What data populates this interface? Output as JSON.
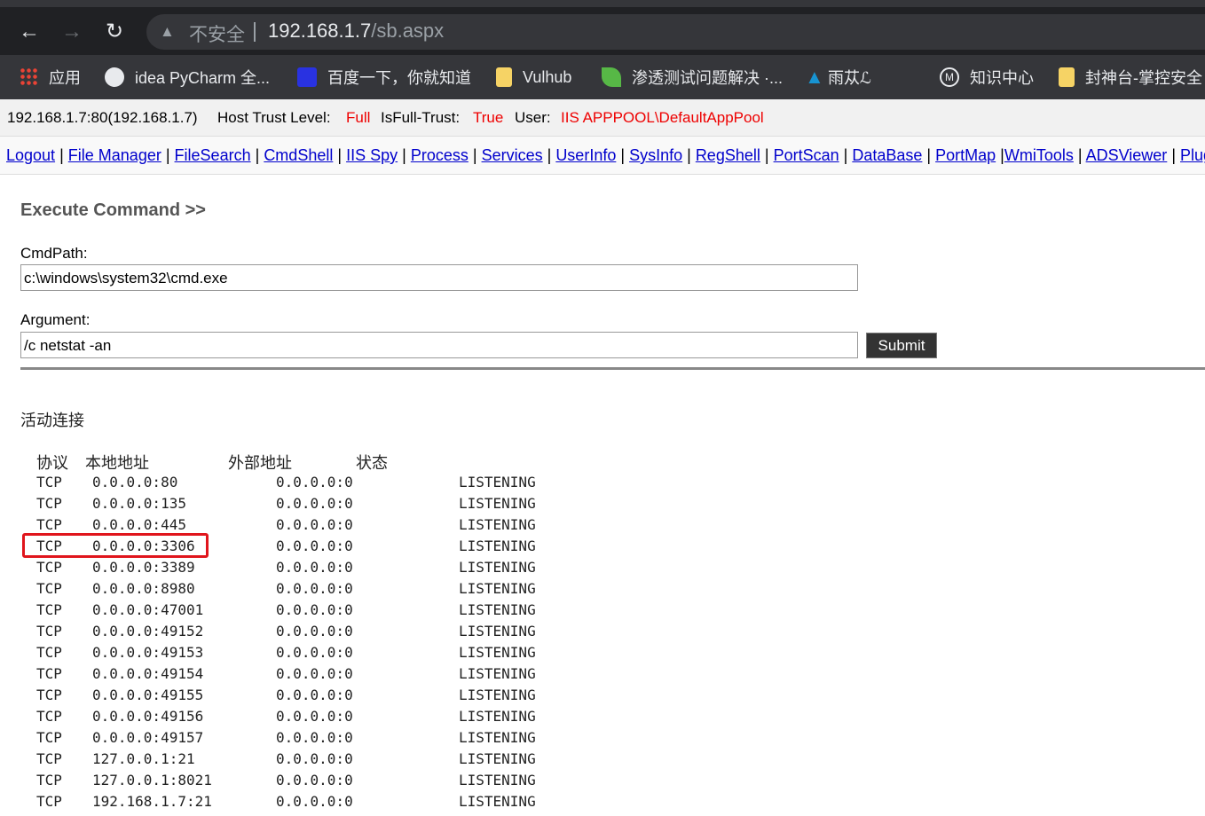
{
  "browser": {
    "security_label": "不安全",
    "url_host": "192.168.1.7",
    "url_path": "/sb.aspx",
    "bookmarks": [
      {
        "label": "应用",
        "icon": "apps-grid-icon"
      },
      {
        "label": "idea PyCharm 全...",
        "icon": "globe-icon"
      },
      {
        "label": "百度一下，你就知道",
        "icon": "baidu-icon"
      },
      {
        "label": "Vulhub",
        "icon": "folder-icon"
      },
      {
        "label": "渗透测试问题解决 ·...",
        "icon": "leaf-icon"
      },
      {
        "label": "雨苁ℒ",
        "icon": "arch-icon"
      },
      {
        "label": "知识中心",
        "icon": "m-circle-icon"
      },
      {
        "label": "封神台-掌控安全",
        "icon": "folder-icon"
      }
    ]
  },
  "info": {
    "host": "192.168.1.7:80(192.168.1.7)",
    "trust_label": "Host Trust Level:",
    "trust_value": "Full",
    "isfull_label": "IsFull-Trust:",
    "isfull_value": "True",
    "user_label": "User:",
    "user_value": "IIS APPPOOL\\DefaultAppPool"
  },
  "menu": [
    "Logout",
    "File Manager",
    "FileSearch",
    "CmdShell",
    "IIS Spy",
    "Process",
    "Services",
    "UserInfo",
    "SysInfo",
    "RegShell",
    "PortScan",
    "DataBase",
    "PortMap",
    "WmiTools",
    "ADSViewer",
    "Plugin"
  ],
  "command": {
    "title": "Execute Command >>",
    "cmdpath_label": "CmdPath:",
    "cmdpath_value": "c:\\windows\\system32\\cmd.exe",
    "argument_label": "Argument:",
    "argument_value": "/c netstat -an",
    "submit_label": "Submit"
  },
  "output": {
    "title": "活动连接",
    "headers": [
      "协议",
      "本地地址",
      "外部地址",
      "状态"
    ],
    "rows": [
      [
        "TCP",
        "0.0.0.0:80",
        "0.0.0.0:0",
        "LISTENING"
      ],
      [
        "TCP",
        "0.0.0.0:135",
        "0.0.0.0:0",
        "LISTENING"
      ],
      [
        "TCP",
        "0.0.0.0:445",
        "0.0.0.0:0",
        "LISTENING"
      ],
      [
        "TCP",
        "0.0.0.0:3306",
        "0.0.0.0:0",
        "LISTENING"
      ],
      [
        "TCP",
        "0.0.0.0:3389",
        "0.0.0.0:0",
        "LISTENING"
      ],
      [
        "TCP",
        "0.0.0.0:8980",
        "0.0.0.0:0",
        "LISTENING"
      ],
      [
        "TCP",
        "0.0.0.0:47001",
        "0.0.0.0:0",
        "LISTENING"
      ],
      [
        "TCP",
        "0.0.0.0:49152",
        "0.0.0.0:0",
        "LISTENING"
      ],
      [
        "TCP",
        "0.0.0.0:49153",
        "0.0.0.0:0",
        "LISTENING"
      ],
      [
        "TCP",
        "0.0.0.0:49154",
        "0.0.0.0:0",
        "LISTENING"
      ],
      [
        "TCP",
        "0.0.0.0:49155",
        "0.0.0.0:0",
        "LISTENING"
      ],
      [
        "TCP",
        "0.0.0.0:49156",
        "0.0.0.0:0",
        "LISTENING"
      ],
      [
        "TCP",
        "0.0.0.0:49157",
        "0.0.0.0:0",
        "LISTENING"
      ],
      [
        "TCP",
        "127.0.0.1:21",
        "0.0.0.0:0",
        "LISTENING"
      ],
      [
        "TCP",
        "127.0.0.1:8021",
        "0.0.0.0:0",
        "LISTENING"
      ],
      [
        "TCP",
        "192.168.1.7:21",
        "0.0.0.0:0",
        "LISTENING"
      ]
    ],
    "highlighted_row": 3,
    "highlight_color": "#e0151c"
  }
}
